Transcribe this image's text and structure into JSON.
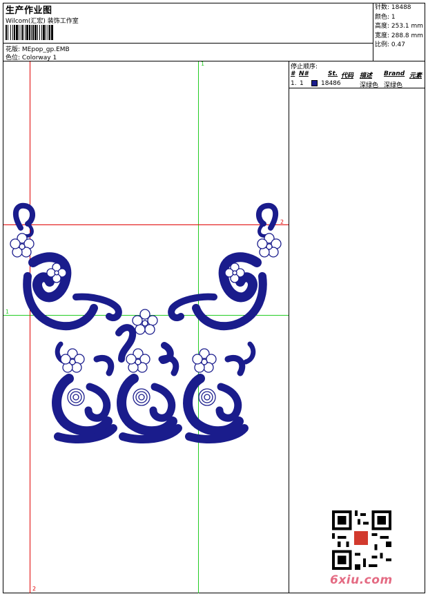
{
  "header": {
    "title": "生产作业图",
    "studio": "Wilcom(汇宏) 装饰工作室",
    "design_label": "花版:",
    "design_value": "MEpop_gp.EMB",
    "colorway_label": "色位:",
    "colorway_value": "Colorway 1"
  },
  "stats": {
    "stitches": "针数: 18488",
    "colors": "颜色: 1",
    "height": "高度: 253.1 mm",
    "width": "宽度: 288.8 mm",
    "scale": "比例: 0.47"
  },
  "stop_sequence": {
    "title": "停止顺序:",
    "columns": [
      "#",
      "N#",
      "St.",
      "代码",
      "描述",
      "Brand",
      "元素"
    ],
    "rows": [
      {
        "index": "1.",
        "needle": "1",
        "stitches": "18486",
        "desc": "深绿色",
        "brand": "深绿色",
        "swatch": "#1a1c8c"
      }
    ]
  },
  "guides": {
    "green_top": "1",
    "green_left": "1",
    "red_right": "2",
    "red_bottom": "2"
  },
  "colors": {
    "thread": "#1a1c8c",
    "guide_red": "#e00000",
    "guide_green": "#22cc22"
  },
  "watermark": "6xiu.com"
}
